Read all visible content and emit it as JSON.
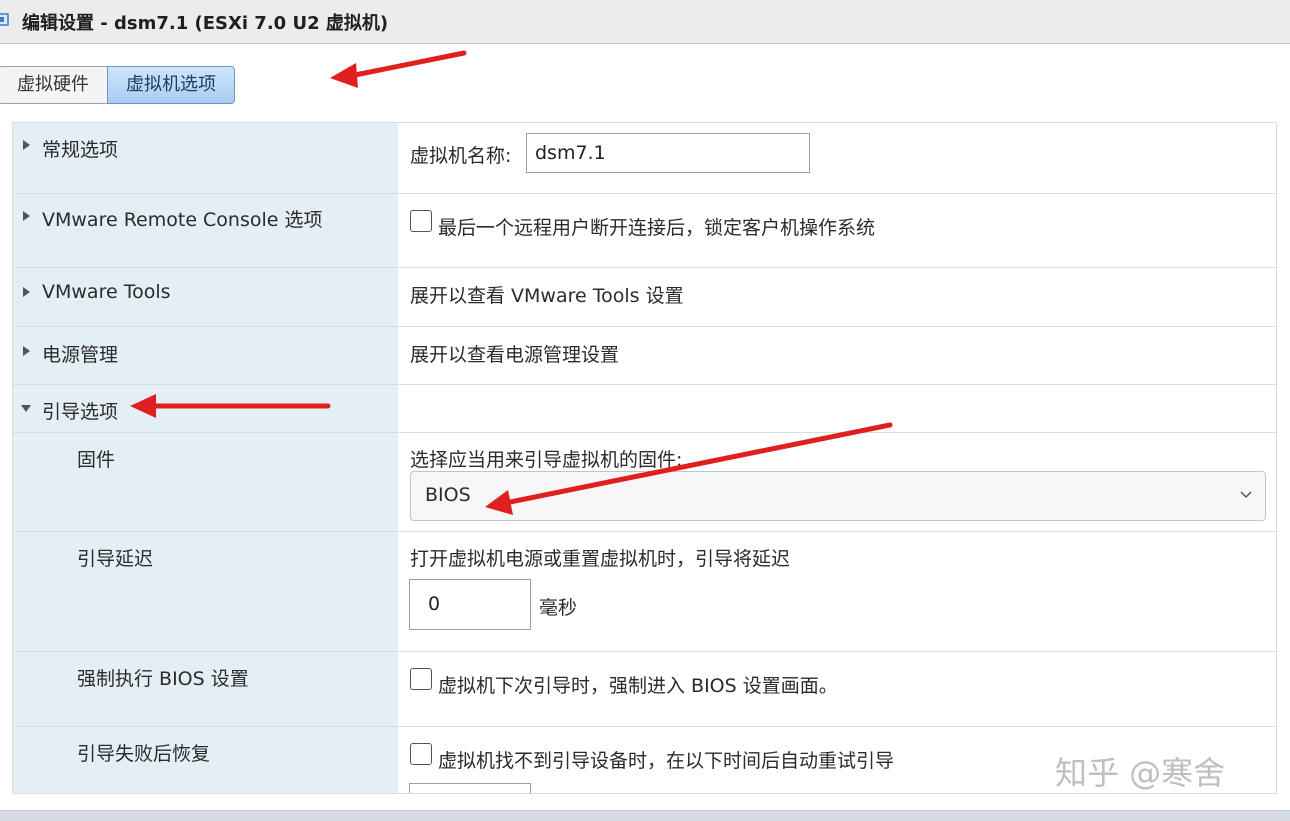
{
  "window": {
    "title": "编辑设置 - dsm7.1 (ESXi 7.0 U2 虚拟机)"
  },
  "tabs": [
    {
      "label": "虚拟硬件",
      "active": false
    },
    {
      "label": "虚拟机选项",
      "active": true
    }
  ],
  "sections": {
    "general": {
      "label": "常规选项",
      "name_label": "虚拟机名称:",
      "name_value": "dsm7.1"
    },
    "vmrc": {
      "label": "VMware Remote Console 选项",
      "lock_label": "最后一个远程用户断开连接后，锁定客户机操作系统",
      "lock_checked": false
    },
    "tools": {
      "label": "VMware Tools",
      "desc": "展开以查看 VMware Tools 设置"
    },
    "power": {
      "label": "电源管理",
      "desc": "展开以查看电源管理设置"
    },
    "boot": {
      "label": "引导选项",
      "firmware": {
        "label": "固件",
        "desc": "选择应当用来引导虚拟机的固件:",
        "selected": "BIOS"
      },
      "delay": {
        "label": "引导延迟",
        "desc": "打开虚拟机电源或重置虚拟机时，引导将延迟",
        "value": "0",
        "unit": "毫秒"
      },
      "force_bios": {
        "label": "强制执行 BIOS 设置",
        "checkbox_label": "虚拟机下次引导时，强制进入 BIOS 设置画面。",
        "checked": false
      },
      "recovery": {
        "label": "引导失败后恢复",
        "checkbox_label": "虚拟机找不到引导设备时，在以下时间后自动重试引导",
        "checked": false
      }
    }
  },
  "watermark": "知乎 @寒舍",
  "colors": {
    "left_column_bg": "#e4eef5",
    "active_tab": "#a9cdf1",
    "annotation_arrow": "#e02020"
  }
}
